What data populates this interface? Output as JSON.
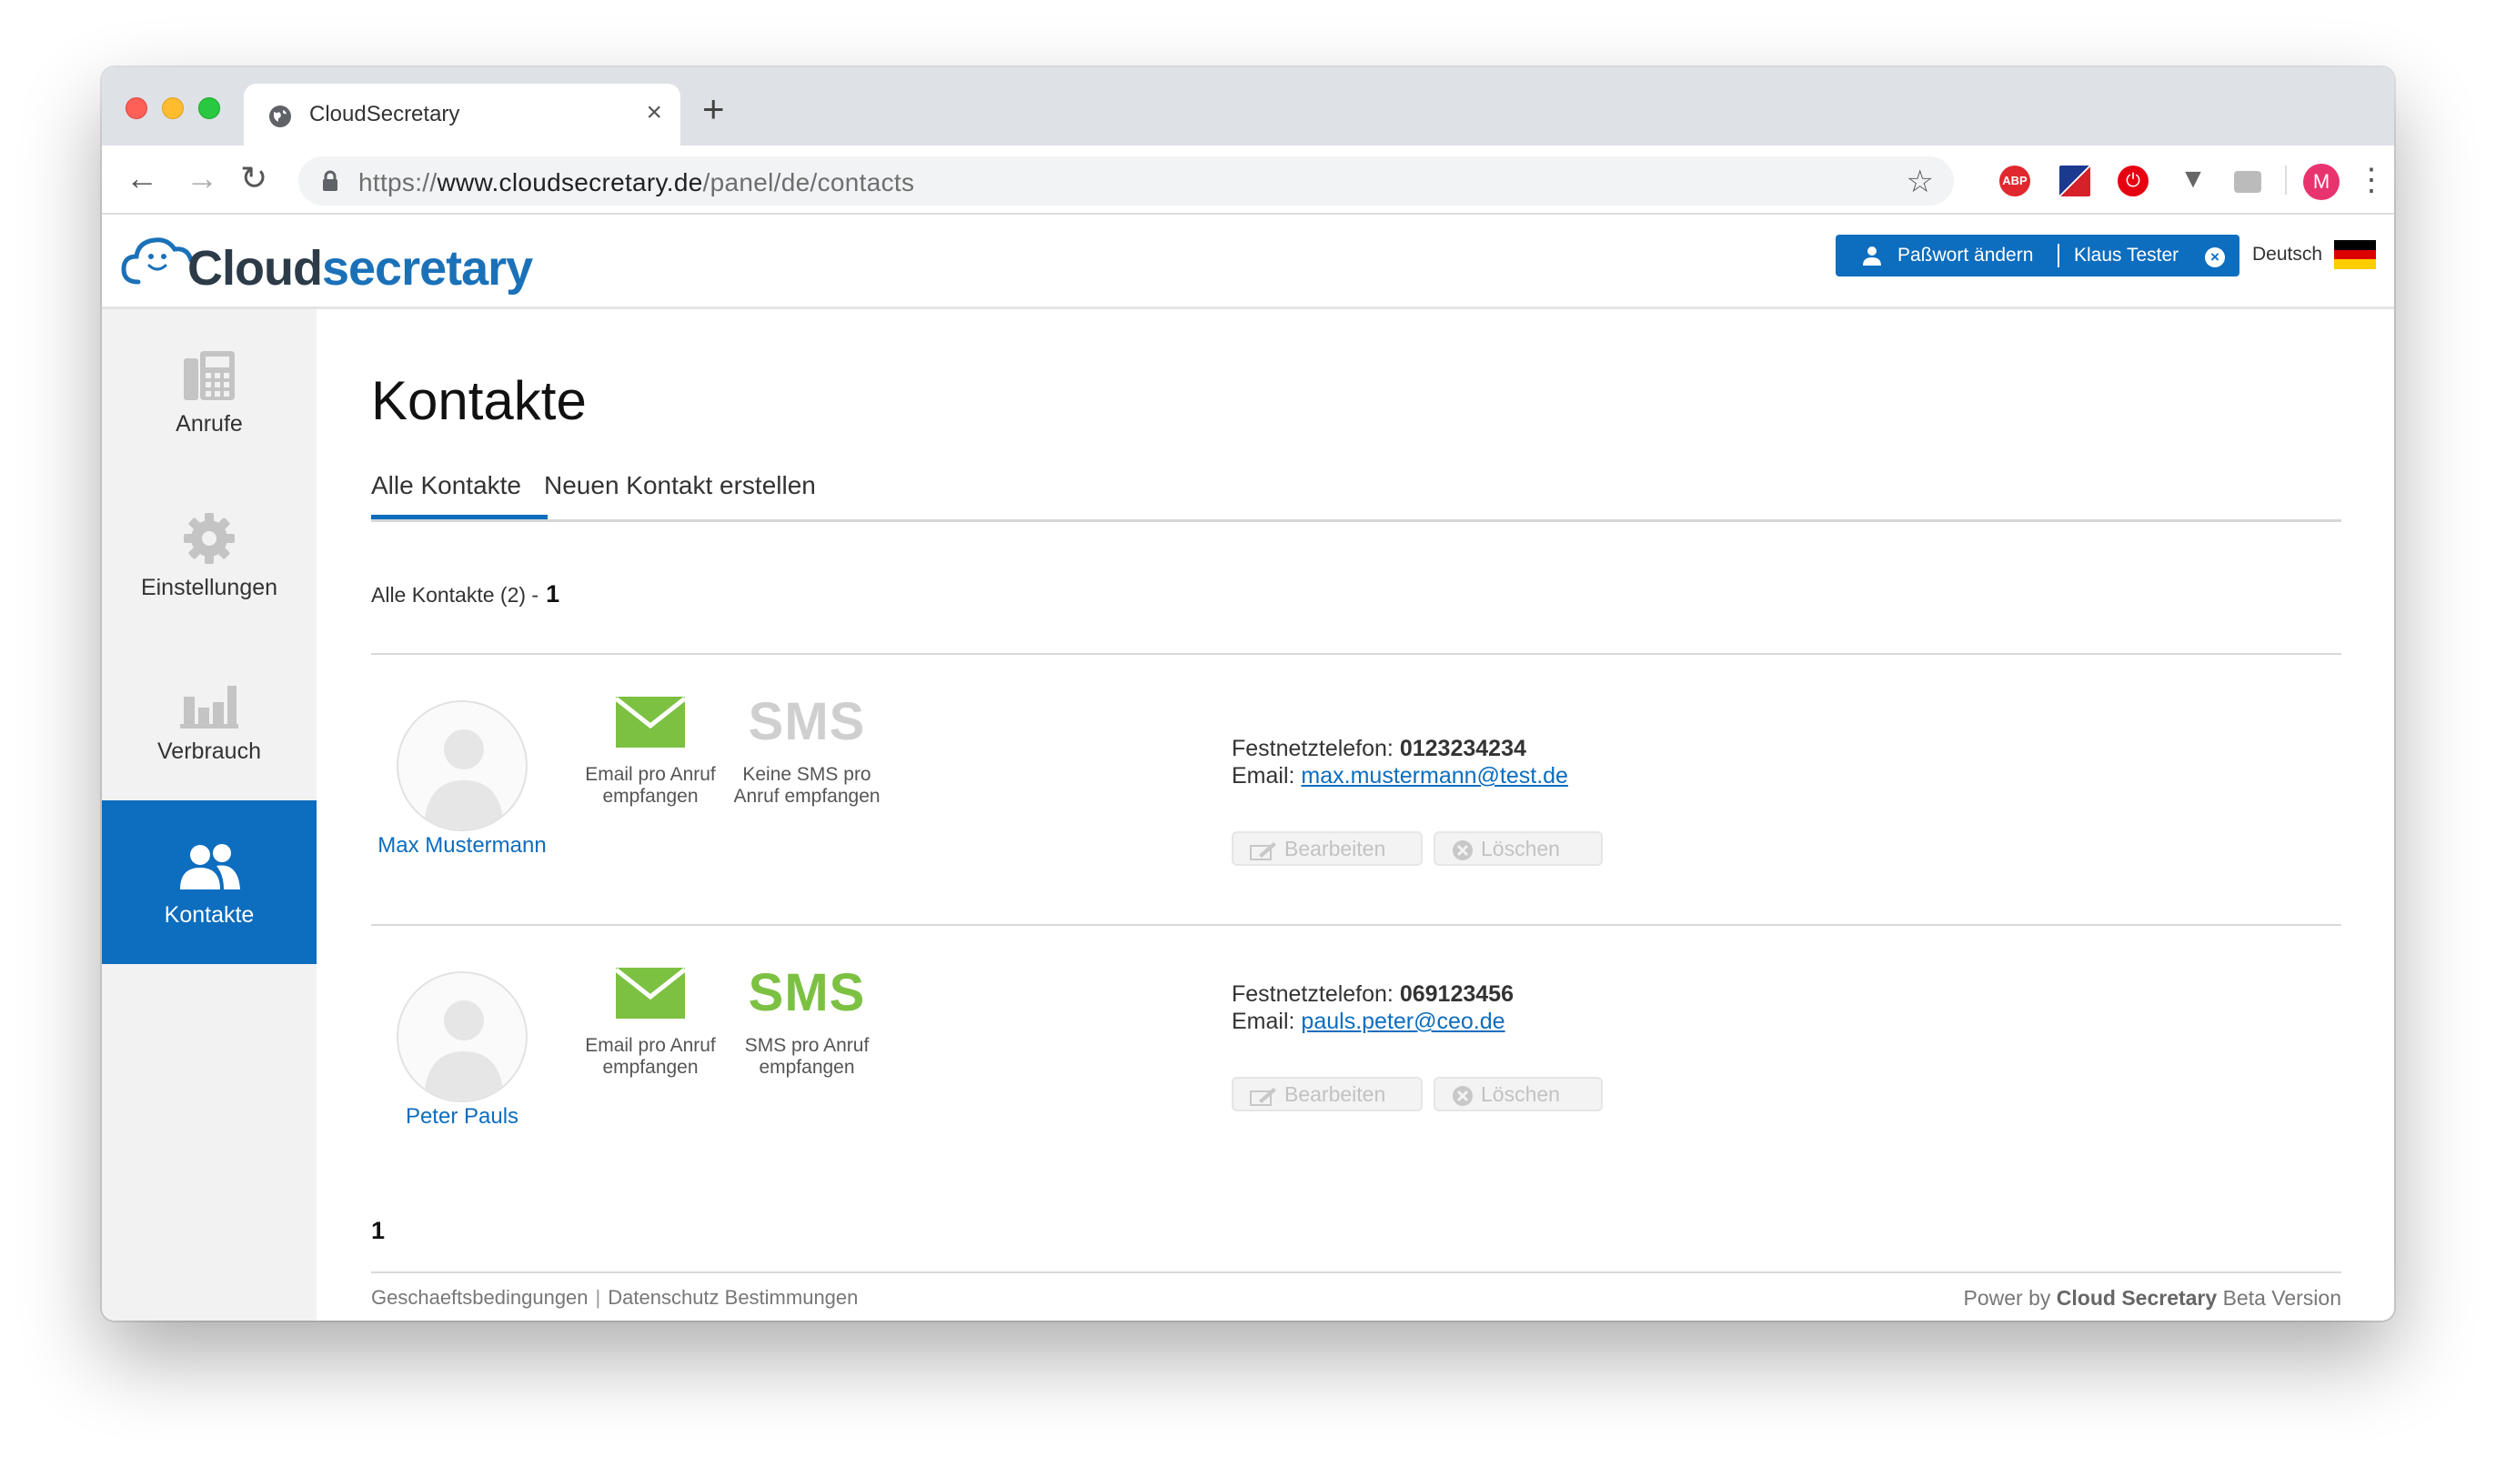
{
  "browser": {
    "tab_title": "CloudSecretary",
    "tab_close": "×",
    "new_tab": "+",
    "url_prefix": "https://",
    "url_host": "www.cloudsecretary.de",
    "url_path": "/panel/de/contacts",
    "back": "←",
    "forward": "→",
    "reload": "↻",
    "star": "☆",
    "abp": "ABP",
    "power": "⏻",
    "vee": "▼",
    "avatar_letter": "M",
    "menu": "⋮"
  },
  "header": {
    "logo_part1": "Cloud",
    "logo_part2": "secretary",
    "change_password": "Paßwort ändern",
    "user_name": "Klaus Tester",
    "logout": "×",
    "language": "Deutsch",
    "flag_colors": [
      "#000000",
      "#dd0000",
      "#ffce00"
    ]
  },
  "sidebar": {
    "items": [
      {
        "label": "Anrufe",
        "icon": "phone-icon"
      },
      {
        "label": "Einstellungen",
        "icon": "gear-icon"
      },
      {
        "label": "Verbrauch",
        "icon": "bar-chart-icon"
      },
      {
        "label": "Kontakte",
        "icon": "contacts-icon",
        "active": true
      }
    ]
  },
  "main": {
    "title": "Kontakte",
    "tabs": [
      {
        "label": "Alle Kontakte",
        "active": true
      },
      {
        "label": "Neuen Kontakt erstellen"
      }
    ],
    "summary": "Alle Kontakte (2) -",
    "page_number": "1",
    "pager_bottom": "1",
    "phone_label": "Festnetztelefon:",
    "email_label": "Email:",
    "edit_label": "Bearbeiten",
    "delete_label": "Löschen",
    "sms_word": "SMS",
    "contacts": [
      {
        "name": "Max Mustermann",
        "email_feature": "Email pro Anruf empfangen",
        "sms_feature": "Keine SMS pro Anruf empfangen",
        "sms_enabled": false,
        "phone": "0123234234",
        "email": "max.mustermann@test.de"
      },
      {
        "name": "Peter Pauls",
        "email_feature": "Email pro Anruf empfangen",
        "sms_feature": "SMS pro Anruf empfangen",
        "sms_enabled": true,
        "phone": "069123456",
        "email": "pauls.peter@ceo.de"
      }
    ]
  },
  "footer": {
    "terms": "Geschaeftsbedingungen",
    "separator": "|",
    "privacy": "Datenschutz Bestimmungen",
    "power_by": "Power by",
    "brand": "Cloud Secretary",
    "version": "Beta Version"
  },
  "colors": {
    "accent": "#0d6dbe",
    "green": "#7cc142",
    "disabled": "#c8c8c8"
  }
}
